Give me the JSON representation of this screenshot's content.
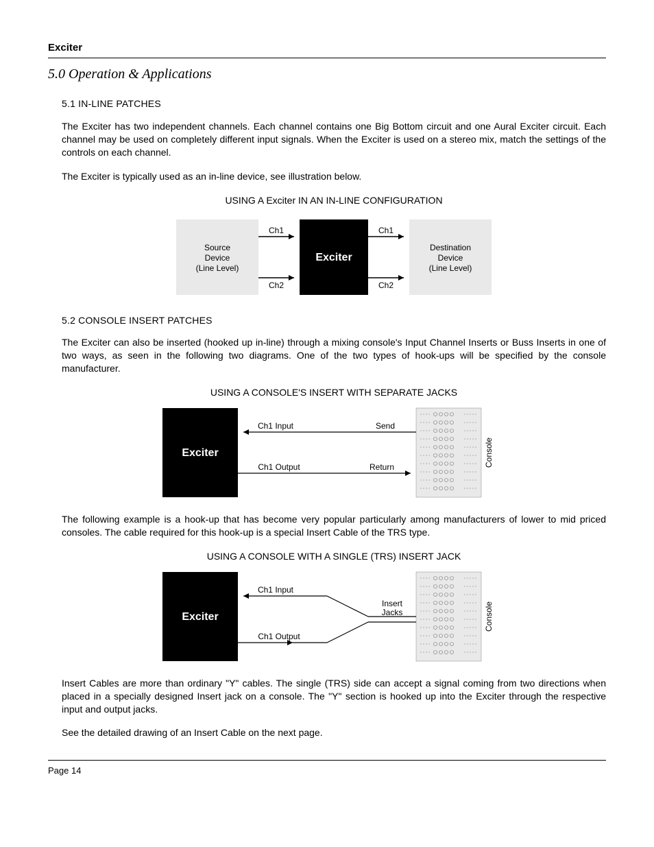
{
  "header": {
    "title": "Exciter"
  },
  "section": {
    "heading": "5.0 Operation & Applications"
  },
  "s51": {
    "heading": "5.1 IN-LINE PATCHES",
    "p1": "The Exciter has two independent channels. Each channel contains one Big Bottom circuit and one Aural Exciter circuit. Each channel may be used on completely different input signals. When the Exciter is used on a stereo mix, match the settings of the controls on each channel.",
    "p2": "The Exciter is typically used as an in-line device, see illustration below."
  },
  "diagram1": {
    "title": "USING A Exciter IN AN IN-LINE CONFIGURATION",
    "source_l1": "Source",
    "source_l2": "Device",
    "source_l3": "(Line Level)",
    "dest_l1": "Destination",
    "dest_l2": "Device",
    "dest_l3": "(Line Level)",
    "center": "Exciter",
    "ch1": "Ch1",
    "ch2": "Ch2"
  },
  "s52": {
    "heading": "5.2 CONSOLE INSERT PATCHES",
    "p1": "The Exciter can also be inserted (hooked up in-line) through a mixing console's Input Channel Inserts or Buss Inserts in one of two ways, as seen in the following two diagrams. One of the two types of hook-ups will be specified by the console manufacturer."
  },
  "diagram2": {
    "title": "USING A CONSOLE'S INSERT WITH SEPARATE JACKS",
    "exciter": "Exciter",
    "ch1_in": "Ch1 Input",
    "ch1_out": "Ch1 Output",
    "send": "Send",
    "return": "Return",
    "console": "Console"
  },
  "para_mid": "The following example is a hook-up that has become very popular particularly among manufacturers of lower to mid priced consoles. The cable required for this hook-up is a special Insert Cable of the TRS type.",
  "diagram3": {
    "title": "USING A CONSOLE WITH A SINGLE (TRS) INSERT JACK",
    "exciter": "Exciter",
    "ch1_in": "Ch1 Input",
    "ch1_out": "Ch1 Output",
    "insert_l1": "Insert",
    "insert_l2": "Jacks",
    "console": "Console"
  },
  "closing": {
    "p1": "Insert Cables are more than ordinary \"Y\" cables. The single (TRS) side can accept a signal coming from two directions when placed in a specially designed Insert jack on a console. The \"Y\" section is hooked up into the Exciter through the respective input and output jacks.",
    "p2": "See the detailed drawing of an Insert Cable on the next page."
  },
  "footer": {
    "page": "Page 14"
  }
}
